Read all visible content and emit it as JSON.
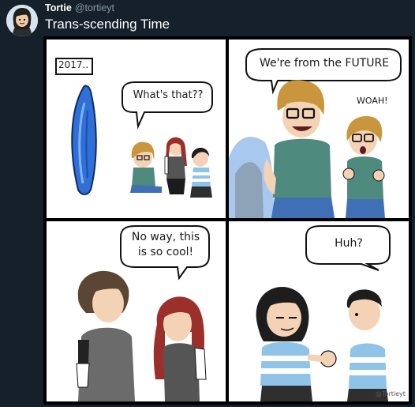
{
  "tweet": {
    "display_name": "Tortie",
    "handle": "@tortieyt",
    "text": "Trans-scending Time"
  },
  "comic": {
    "panel1": {
      "caption": "2017..",
      "speech": "What's that??"
    },
    "panel2": {
      "speech": "We're from the FUTURE",
      "exclamation": "WOAH!"
    },
    "panel3": {
      "speech_line1": "No way, this",
      "speech_line2": "is so cool!"
    },
    "panel4": {
      "speech": "Huh?",
      "signature": "@Tortieyt"
    }
  },
  "colors": {
    "background": "#15202b",
    "handle": "#8899a6",
    "portal_blue": "#2f6fd6",
    "shirt_teal": "#4f8a7e",
    "jeans_blue": "#3f6fb5",
    "hair_blonde": "#c9963e",
    "hair_red": "#9b2f2a",
    "hair_dark": "#1d1d1d"
  },
  "icons": {
    "avatar": "profile-avatar-icon"
  }
}
